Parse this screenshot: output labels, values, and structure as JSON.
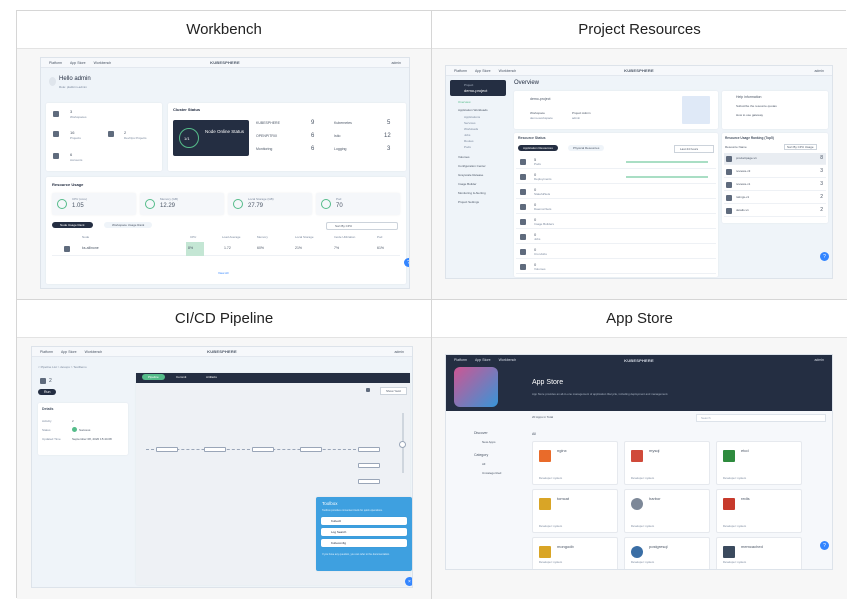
{
  "panels": [
    {
      "title": "Workbench"
    },
    {
      "title": "Project Resources"
    },
    {
      "title": "CI/CD Pipeline"
    },
    {
      "title": "App Store"
    }
  ],
  "nav": {
    "platform": "Platform",
    "app_store": "App Store",
    "workbench": "Workbench",
    "logo": "KUBESPHERE",
    "user": "admin"
  },
  "workbench": {
    "greeting": "Hello admin",
    "role": "Role: platform-admin",
    "stat_ws_count": "3",
    "stat_ws_label": "Workspaces",
    "stat_proj_count": "16",
    "stat_proj_label": "Projects",
    "stat_dev_count": "2",
    "stat_dev_label": "DevOps Projects",
    "stat_acc_count": "6",
    "stat_acc_label": "Accounts",
    "cluster_status": "Cluster Status",
    "node_online": "Node Online Status",
    "node_ratio": "1/1",
    "components": [
      {
        "name": "KUBESPHERE",
        "value": "9"
      },
      {
        "name": "Kubernetes",
        "value": "5"
      },
      {
        "name": "OPENPITRIX",
        "value": "6"
      },
      {
        "name": "Istio",
        "value": "12"
      },
      {
        "name": "Monitoring",
        "value": "6"
      },
      {
        "name": "Logging",
        "value": "3"
      }
    ],
    "resource_usage": "Resource Usage",
    "usage": [
      {
        "label": "CPU (core)",
        "value": "1.05"
      },
      {
        "label": "Memory (GB)",
        "value": "12.29"
      },
      {
        "label": "Local Storage (GB)",
        "value": "27.79"
      },
      {
        "label": "Pod",
        "value": "70"
      }
    ],
    "tab_node": "Node Usage Rank",
    "tab_ws": "Workspace Usage Rank",
    "sort": "Sort By CPU",
    "table_head": [
      "Node",
      "CPU",
      "Load Average",
      "Memory",
      "Local Storage",
      "Inode Utilization",
      "Pod"
    ],
    "table_row": [
      "ks-allinone",
      "8%",
      "1.72",
      "60%",
      "21%",
      "7%",
      "61%"
    ],
    "view_all": "View All"
  },
  "project": {
    "project_label": "Project",
    "project_name": "demo-project",
    "sidebar": [
      "Overview",
      "Application Workloads",
      "Applications",
      "Services",
      "Workloads",
      "Jobs",
      "Routes",
      "Pods",
      "Volumes",
      "Configuration Center",
      "Grayscale Release",
      "Image Builder",
      "Monitoring & Alerting",
      "Project Settings"
    ],
    "overview": "Overview",
    "proj_title": "demo-project",
    "ws_label": "Workspace",
    "ws_value": "demo-workspace",
    "admin_label": "Project Admin",
    "admin_value": "admin",
    "tips": "Tips",
    "tip_items": [
      "Help information",
      "Subscribe the resource quotas",
      "How to use gateway"
    ],
    "res_status": "Resource Status",
    "seg_app": "Application Resources",
    "seg_phys": "Physical Resources",
    "time_range": "Last 24 hours",
    "resources": [
      {
        "count": "5",
        "label": "Pods"
      },
      {
        "count": "0",
        "label": "Deployments"
      },
      {
        "count": "0",
        "label": "StatefulSets"
      },
      {
        "count": "0",
        "label": "DaemonSets"
      },
      {
        "count": "0",
        "label": "Image Builders"
      },
      {
        "count": "0",
        "label": "Jobs"
      },
      {
        "count": "0",
        "label": "CronJobs"
      },
      {
        "count": "0",
        "label": "Volumes"
      }
    ],
    "rank_title": "Resource Usage Ranking (Top5)",
    "rank_col": "Resource Name",
    "rank_sort": "Sort By CPU Usage",
    "rank_items": [
      {
        "name": "productpage-v1",
        "value": "8"
      },
      {
        "name": "reviews-v3",
        "value": "3"
      },
      {
        "name": "reviews-v1",
        "value": "3"
      },
      {
        "name": "ratings-v1",
        "value": "2"
      },
      {
        "name": "details-v1",
        "value": "2"
      }
    ]
  },
  "pipeline": {
    "breadcrumb": "< Pipeline List > devops > TestDemo",
    "run_count": "2",
    "run_button": "Run",
    "details": "Details",
    "detail_rows": [
      {
        "k": "Activity",
        "v": "2"
      },
      {
        "k": "Status",
        "v": "Success"
      },
      {
        "k": "Updated Time",
        "v": "September 08, 2020 15:44:08"
      }
    ],
    "tabs": [
      "Pipeline",
      "Commit",
      "Artifacts"
    ],
    "show_yaml": "Show Yaml",
    "toolbox": "Toolbox",
    "toolbox_desc": "Toolbox provides convenient tools for quick operations.",
    "tools": [
      "Kubectl",
      "Log Search",
      "Kubeconfig"
    ],
    "toolbox_tip": "If you have any question, you can refer to the documentation."
  },
  "appstore": {
    "title": "App Store",
    "subtitle": "App Store provides an all-in-one management of application lifecycle, including deployment and management.",
    "total": "20 Apps in Total",
    "search": "Search",
    "discover": "Discover",
    "new_apps": "New Apps",
    "category": "Category",
    "cat_all": "All",
    "cat_uncat": "Uncategorized",
    "all_label": "All",
    "apps": [
      {
        "name": "nginx",
        "org": "Developer: system",
        "icon": "nginx-icon"
      },
      {
        "name": "mysql",
        "org": "Developer: system",
        "icon": "mysql-icon"
      },
      {
        "name": "etcd",
        "org": "Developer: system",
        "icon": "etcd-icon"
      },
      {
        "name": "tomcat",
        "org": "Developer: system",
        "icon": "tomcat-icon"
      },
      {
        "name": "harbor",
        "org": "Developer: system",
        "icon": "harbor-icon"
      },
      {
        "name": "redis",
        "org": "Developer: system",
        "icon": "redis-icon"
      },
      {
        "name": "mongodb",
        "org": "Developer: system",
        "icon": "mongodb-icon"
      },
      {
        "name": "postgresql",
        "org": "Developer: system",
        "icon": "postgresql-icon"
      },
      {
        "name": "memcached",
        "org": "Developer: system",
        "icon": "memcached-icon"
      }
    ]
  },
  "colors": {
    "accent": "#3385ff",
    "dark": "#242e42",
    "green": "#55bc8a"
  }
}
